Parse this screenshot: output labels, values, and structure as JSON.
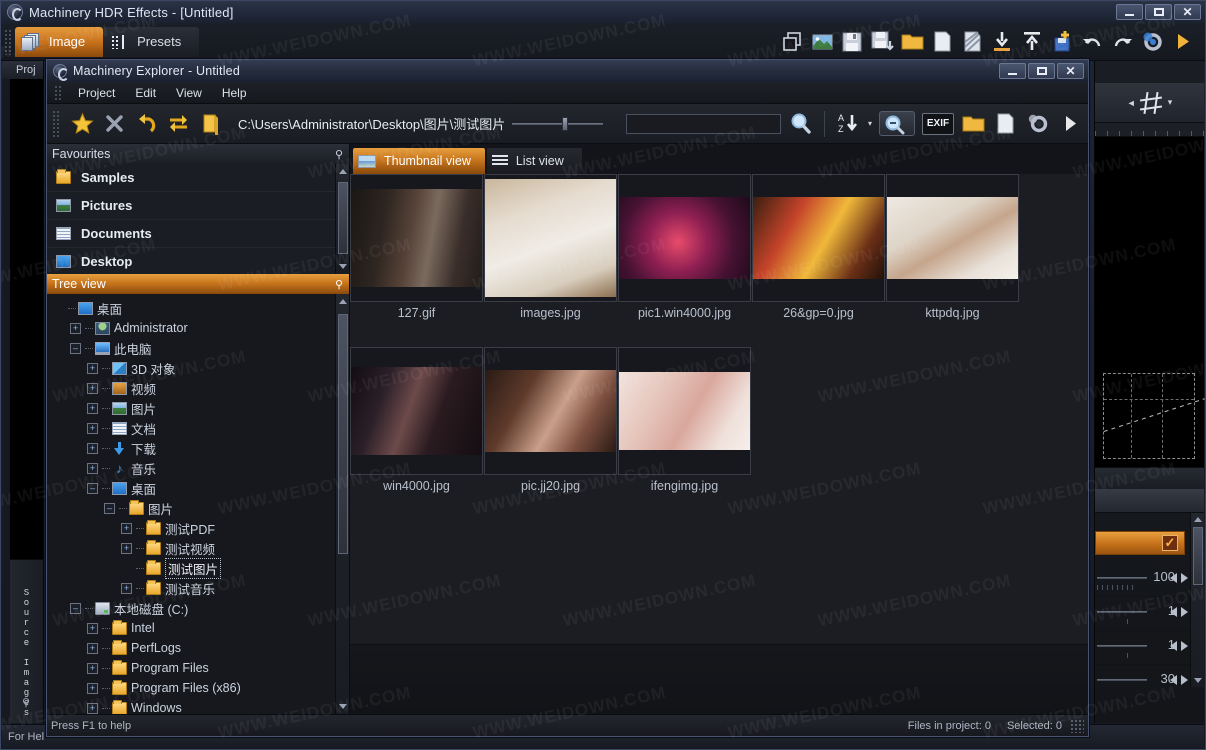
{
  "app": {
    "title": "Machinery HDR Effects - [Untitled]",
    "window_buttons": {
      "minimize": "—",
      "maximize": "□",
      "close": "✕"
    },
    "mode_tabs": [
      {
        "label": "Image",
        "icon": "layers-icon",
        "active": true
      },
      {
        "label": "Presets",
        "icon": "presets-icon",
        "active": false
      }
    ],
    "toolbar_icons": [
      "duplicate-icon",
      "image-icon",
      "save-icon",
      "save-as-icon",
      "open-folder-icon",
      "new-file-icon",
      "batch-icon",
      "import-icon",
      "export-icon",
      "add-save-icon",
      "undo-icon",
      "redo-icon",
      "settings-icon",
      "play-icon"
    ],
    "status": "For Hel"
  },
  "project_strip": {
    "tab_label": "Proj",
    "source_images_label": "Source Images",
    "pin_icon": "pin-icon"
  },
  "right_panel": {
    "crop_icon": "crop-icon",
    "check_icon": "checkmark-icon",
    "sliders": [
      {
        "value": "100"
      },
      {
        "value": "1"
      },
      {
        "value": "1"
      },
      {
        "value": "30"
      }
    ]
  },
  "explorer": {
    "title": "Machinery Explorer - Untitled",
    "window_buttons": {
      "minimize": "—",
      "maximize": "□",
      "close": "✕"
    },
    "menu": [
      "Project",
      "Edit",
      "View",
      "Help"
    ],
    "toolbar": {
      "favourite_icon": "star-icon",
      "remove_icon": "close-x-icon",
      "back_icon": "undo-arrow-icon",
      "refresh_icon": "refresh-icon",
      "folder_icon": "folder-icon",
      "path": "C:\\Users\\Administrator\\Desktop\\图片\\测试图片",
      "search_placeholder": "",
      "search_value": "",
      "search_icon": "magnifier-icon",
      "sort_icon": "sort-az-icon",
      "zoom_out_icon": "zoom-out-icon",
      "exif_label": "EXIF",
      "open_folder_icon": "folder-icon",
      "new_icon": "page-icon",
      "settings_icon": "gear-icon",
      "play_icon": "play-icon"
    },
    "favourites": {
      "title": "Favourites",
      "items": [
        {
          "label": "Samples",
          "icon": "folder-icon"
        },
        {
          "label": "Pictures",
          "icon": "picture-icon"
        },
        {
          "label": "Documents",
          "icon": "document-icon"
        },
        {
          "label": "Desktop",
          "icon": "desktop-icon"
        }
      ]
    },
    "tree": {
      "title": "Tree view",
      "items": [
        {
          "label": "桌面",
          "indent": 0,
          "toggle": "",
          "icon": "desktop-icon"
        },
        {
          "label": "Administrator",
          "indent": 1,
          "toggle": "+",
          "icon": "user-icon"
        },
        {
          "label": "此电脑",
          "indent": 1,
          "toggle": "-",
          "icon": "computer-icon"
        },
        {
          "label": "3D 对象",
          "indent": 2,
          "toggle": "+",
          "icon": "cube-icon"
        },
        {
          "label": "视频",
          "indent": 2,
          "toggle": "+",
          "icon": "video-icon"
        },
        {
          "label": "图片",
          "indent": 2,
          "toggle": "+",
          "icon": "picture-icon"
        },
        {
          "label": "文档",
          "indent": 2,
          "toggle": "+",
          "icon": "document-icon"
        },
        {
          "label": "下载",
          "indent": 2,
          "toggle": "+",
          "icon": "download-icon"
        },
        {
          "label": "音乐",
          "indent": 2,
          "toggle": "+",
          "icon": "music-icon"
        },
        {
          "label": "桌面",
          "indent": 2,
          "toggle": "-",
          "icon": "desktop-icon"
        },
        {
          "label": "图片",
          "indent": 3,
          "toggle": "-",
          "icon": "folder-icon"
        },
        {
          "label": "测试PDF",
          "indent": 4,
          "toggle": "+",
          "icon": "folder-icon"
        },
        {
          "label": "测试视频",
          "indent": 4,
          "toggle": "+",
          "icon": "folder-icon"
        },
        {
          "label": "测试图片",
          "indent": 4,
          "toggle": "",
          "icon": "folder-icon",
          "selected": true
        },
        {
          "label": "测试音乐",
          "indent": 4,
          "toggle": "+",
          "icon": "folder-icon"
        },
        {
          "label": "本地磁盘 (C:)",
          "indent": 1,
          "toggle": "-",
          "icon": "disk-icon"
        },
        {
          "label": "Intel",
          "indent": 2,
          "toggle": "+",
          "icon": "folder-icon"
        },
        {
          "label": "PerfLogs",
          "indent": 2,
          "toggle": "+",
          "icon": "folder-icon"
        },
        {
          "label": "Program Files",
          "indent": 2,
          "toggle": "+",
          "icon": "folder-icon"
        },
        {
          "label": "Program Files (x86)",
          "indent": 2,
          "toggle": "+",
          "icon": "folder-icon"
        },
        {
          "label": "Windows",
          "indent": 2,
          "toggle": "+",
          "icon": "folder-icon"
        }
      ]
    },
    "view_tabs": [
      {
        "label": "Thumbnail view",
        "icon": "thumbnail-icon",
        "active": true
      },
      {
        "label": "List view",
        "icon": "list-icon",
        "active": false
      }
    ],
    "files": [
      {
        "name": "127.gif",
        "art": "room"
      },
      {
        "name": "images.jpg",
        "art": "bed"
      },
      {
        "name": "pic1.win4000.jpg",
        "art": "game"
      },
      {
        "name": "26&gp=0.jpg",
        "art": "anime"
      },
      {
        "name": "kttpdq.jpg",
        "art": "pug"
      },
      {
        "name": "win4000.jpg",
        "art": "dark"
      },
      {
        "name": "pic.jj20.jpg",
        "art": "portrait"
      },
      {
        "name": "ifengimg.jpg",
        "art": "pink"
      }
    ],
    "status": {
      "hint": "Press F1 to help",
      "files_in_project": "Files in project: 0",
      "selected": "Selected: 0"
    }
  },
  "watermark": {
    "text": "WWW.WEIDOWN.COM"
  },
  "colors": {
    "accent_orange": "#c8761d",
    "window_blue": "#2c3448",
    "panel_dark": "#16181e"
  }
}
